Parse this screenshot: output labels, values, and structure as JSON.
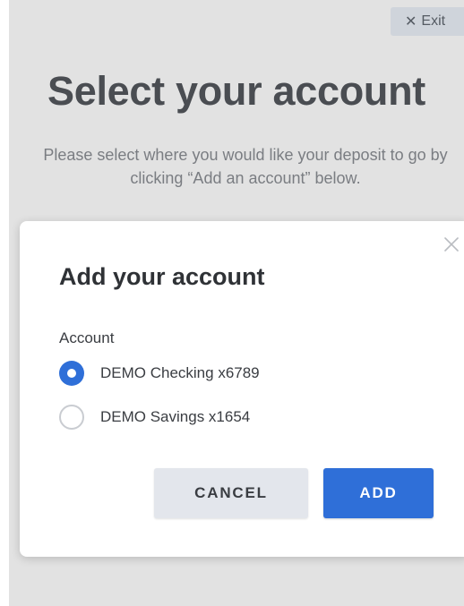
{
  "header": {
    "exit_icon": "close-icon",
    "exit_label": "Exit"
  },
  "page": {
    "title": "Select your account",
    "description": "Please select where you would like your deposit to go by clicking “Add an account” below."
  },
  "modal": {
    "title": "Add your account",
    "close_icon": "close-icon",
    "account_label": "Account",
    "options": [
      {
        "label": "DEMO Checking x6789",
        "selected": true
      },
      {
        "label": "DEMO Savings x1654",
        "selected": false
      }
    ],
    "cancel_label": "CANCEL",
    "add_label": "ADD"
  },
  "colors": {
    "accent": "#2f6fd8",
    "backdrop": "#e2e2e2",
    "title_text": "#4a4d52",
    "cancel_bg": "#e3e6ec"
  }
}
